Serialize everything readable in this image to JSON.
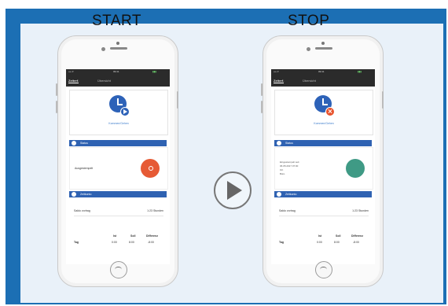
{
  "captions": {
    "start": "START",
    "stop": "STOP"
  },
  "colors": {
    "border_blue": "#1c6fb4",
    "panel_bg": "#e9f1f9",
    "app_blue": "#2f62b2",
    "stop_red": "#e65a35",
    "running_green": "#3f9a85"
  },
  "phone_left": {
    "statusbar": {
      "left": "•••• ▾",
      "center": "09:41",
      "right": "▮▮▮"
    },
    "nav": {
      "tab1": "Zeiterf.",
      "tab2": "Übersicht"
    },
    "clock_label": "Kommen/Gehen",
    "badge_icon": "play-icon",
    "status": {
      "title": "Status",
      "label": "Ausgestempelt",
      "action_icon": "stamp-in-button"
    },
    "balance": {
      "title": "Zeitkonto",
      "row_label": "Saldo vortrag",
      "row_value": "1:23 Stunden",
      "table_headers": [
        "Ist",
        "Soll",
        "Differenz"
      ],
      "table_rows": [
        {
          "label": "Tag",
          "ist": "0:00",
          "soll": "8:00",
          "diff": "-8:00"
        }
      ]
    }
  },
  "phone_right": {
    "statusbar": {
      "left": "•••• ▾",
      "center": "09:41",
      "right": "▮▮▮"
    },
    "nav": {
      "tab1": "Zeiterf.",
      "tab2": "Übersicht"
    },
    "clock_label": "Kommen/Gehen",
    "badge_icon": "stop-icon",
    "status": {
      "title": "Status",
      "lines": [
        "Eingestempelt seit",
        "06.05.2017 07:00",
        "Ort",
        "Büro"
      ],
      "action_icon": "stamp-out-button"
    },
    "balance": {
      "title": "Zeitkonto",
      "row_label": "Saldo vortrag",
      "row_value": "1:23 Stunden",
      "table_headers": [
        "Ist",
        "Soll",
        "Differenz"
      ],
      "table_rows": [
        {
          "label": "Tag",
          "ist": "0:00",
          "soll": "8:00",
          "diff": "-8:00"
        }
      ]
    }
  },
  "center_control": {
    "icon": "play-icon"
  }
}
